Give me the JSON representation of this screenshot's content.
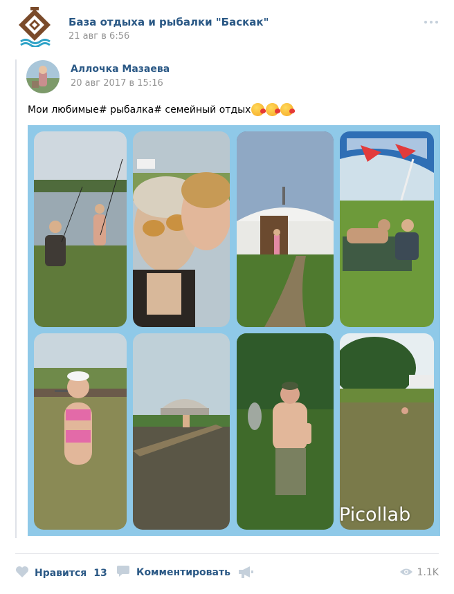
{
  "group": {
    "name": "База отдыха и рыбалки \"Баскак\"",
    "date": "21 авг в 6:56",
    "more_icon": "more-horizontal-icon"
  },
  "repost": {
    "author": "Аллочка Мазаева",
    "date": "20 авг 2017 в 15:16",
    "text": "Мои любимые# рыбалка# семейный отдых",
    "emoji_count": 3,
    "collage_watermark": "Picollab"
  },
  "footer": {
    "like_label": "Нравится",
    "like_count": "13",
    "comment_label": "Комментировать",
    "views": "1.1K"
  },
  "colors": {
    "link": "#2a5885",
    "muted": "#939393",
    "icon": "#c5d0db",
    "collage_bg": "#8fc9e8"
  }
}
